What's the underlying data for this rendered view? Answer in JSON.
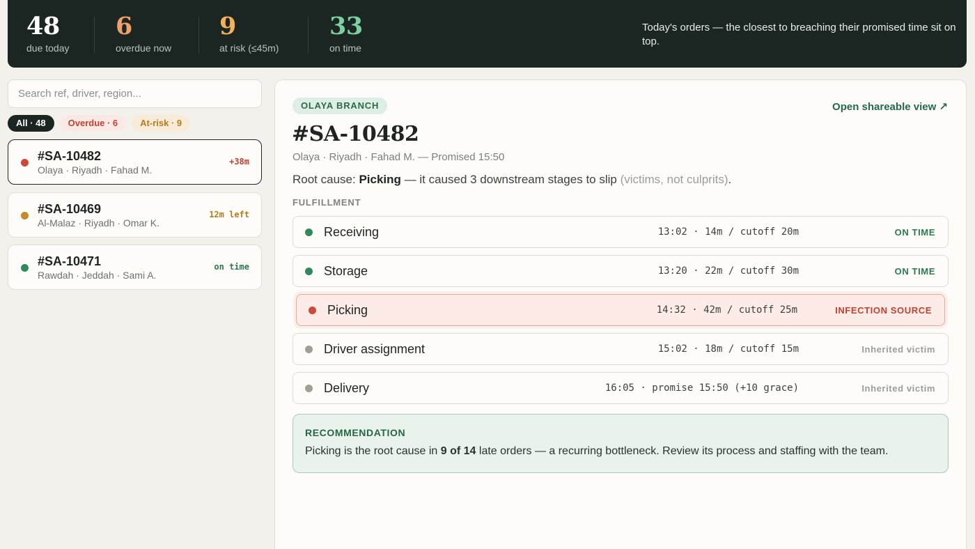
{
  "stats": [
    {
      "value": "48",
      "label": "due today",
      "color": "#ffffff"
    },
    {
      "value": "6",
      "label": "overdue now",
      "color": "#f0a06c"
    },
    {
      "value": "9",
      "label": "at risk (≤45m)",
      "color": "#f2b25a"
    },
    {
      "value": "33",
      "label": "on time",
      "color": "#7ccfa0"
    }
  ],
  "header_description": "Today's orders — the closest to breaching their promised time sit on top.",
  "search": {
    "placeholder": "Search ref, driver, region..."
  },
  "filters": {
    "all": "All · 48",
    "overdue": "Overdue · 6",
    "at_risk": "At-risk · 9"
  },
  "orders": [
    {
      "ref": "#SA-10482",
      "meta": "Olaya · Riyadh · Fahad M.",
      "tag": "+38m",
      "status_color": "#d0473a",
      "tag_color": "#c4402f"
    },
    {
      "ref": "#SA-10469",
      "meta": "Al-Malaz · Riyadh · Omar K.",
      "tag": "12m left",
      "status_color": "#c78a2a",
      "tag_color": "#b97a1e"
    },
    {
      "ref": "#SA-10471",
      "meta": "Rawdah · Jeddah · Sami A.",
      "tag": "on time",
      "status_color": "#2e8a5c",
      "tag_color": "#2c7a52"
    }
  ],
  "detail": {
    "branch": "OLAYA BRANCH",
    "share_link": "Open shareable view ↗",
    "title": "#SA-10482",
    "subtitle": "Olaya · Riyadh · Fahad M. — Promised 15:50",
    "root_cause_prefix": "Root cause: ",
    "root_cause_stage": "Picking",
    "root_cause_middle": " — it caused 3 downstream stages to slip ",
    "root_cause_note": "(victims, not culprits)",
    "root_cause_end": ".",
    "section_label": "FULFILLMENT",
    "stages": [
      {
        "name": "Receiving",
        "timing": "13:02 · 14m / cutoff 20m",
        "status": "ON TIME",
        "dot_color": "#2e8a5c",
        "status_color": "#2c7a52"
      },
      {
        "name": "Storage",
        "timing": "13:20 · 22m / cutoff 30m",
        "status": "ON TIME",
        "dot_color": "#2e8a5c",
        "status_color": "#2c7a52"
      },
      {
        "name": "Picking",
        "timing": "14:32 · 42m / cutoff 25m",
        "status": "INFECTION SOURCE",
        "dot_color": "#d0473a",
        "status_color": "#c4402f"
      },
      {
        "name": "Driver assignment",
        "timing": "15:02 · 18m / cutoff 15m",
        "status": "Inherited victim",
        "dot_color": "#a19e94",
        "status_color": "#9a9e9b"
      },
      {
        "name": "Delivery",
        "timing": "16:05 · promise 15:50 (+10 grace)",
        "status": "Inherited victim",
        "dot_color": "#a19e94",
        "status_color": "#9a9e9b"
      }
    ],
    "recommendation": {
      "label": "RECOMMENDATION",
      "text_prefix": "Picking is the root cause in ",
      "text_bold": "9 of 14",
      "text_suffix": " late orders — a recurring bottleneck. Review its process and staffing with the team."
    }
  }
}
